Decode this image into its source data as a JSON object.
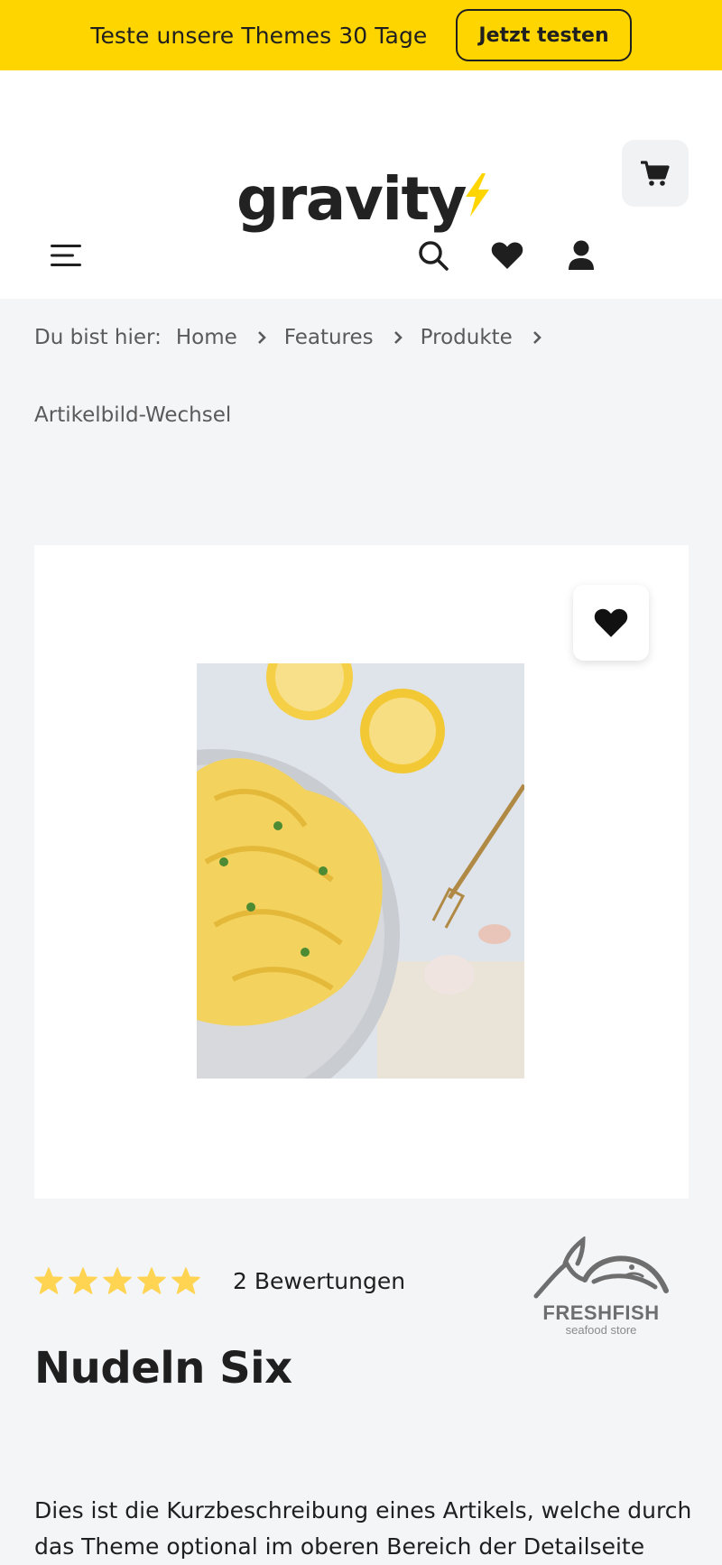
{
  "promo": {
    "text": "Teste unsere Themes 30 Tage",
    "button_label": "Jetzt testen",
    "background": "#ffd500"
  },
  "header": {
    "logo_text": "gravity",
    "logo_accent": "#ffd500",
    "icons": [
      "menu-icon",
      "search-icon",
      "heart-icon",
      "user-icon",
      "cart-icon"
    ]
  },
  "breadcrumb": {
    "prefix": "Du bist hier:",
    "items": [
      "Home",
      "Features",
      "Produkte"
    ],
    "current": "Artikelbild-Wechsel"
  },
  "product": {
    "rating_count_text": "2 Bewertungen",
    "rating_stars": 5,
    "star_color": "#ffd452",
    "brand": {
      "name": "FRESHFISH",
      "tagline": "seafood store"
    },
    "title": "Nudeln Six",
    "short_description": "Dies ist die Kurzbeschreibung eines Artikels, welche durch das Theme optional im oberen Bereich der Detailseite"
  }
}
